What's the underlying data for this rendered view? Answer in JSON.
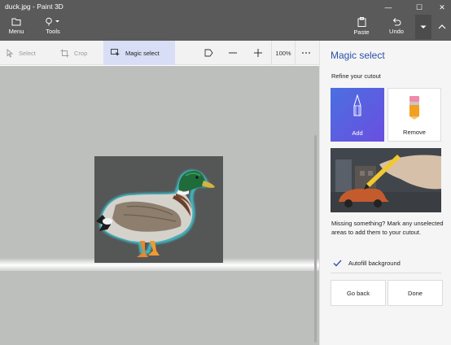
{
  "window": {
    "title": "duck.jpg - Paint 3D",
    "minimize_glyph": "—",
    "maximize_glyph": "☐",
    "close_glyph": "✕"
  },
  "ribbon": {
    "menu_label": "Menu",
    "tools_label": "Tools",
    "paste_label": "Paste",
    "undo_label": "Undo"
  },
  "toolbar": {
    "select_label": "Select",
    "crop_label": "Crop",
    "magic_select_label": "Magic select",
    "zoom_level": "100%"
  },
  "panel": {
    "title": "Magic select",
    "subtitle": "Refine your cutout",
    "add_label": "Add",
    "remove_label": "Remove",
    "help_text": "Missing something? Mark any unselected areas to add them to your cutout.",
    "autofill_label": "Autofill background",
    "autofill_checked": true,
    "go_back_label": "Go back",
    "done_label": "Done"
  },
  "colors": {
    "titlebar": "#5a5a5a",
    "accent": "#2b4fa9",
    "add_tile": "#4b6fe0",
    "selection_glow": "#3ec9d6"
  },
  "icons": [
    "folder-icon",
    "brush-icon",
    "paste-icon",
    "undo-icon",
    "chevron-down-icon",
    "chevron-up-icon",
    "select-icon",
    "crop-icon",
    "magic-select-icon",
    "flag-icon",
    "minus-icon",
    "plus-icon",
    "more-icon",
    "pen-icon",
    "eraser-icon",
    "checkmark-icon"
  ]
}
